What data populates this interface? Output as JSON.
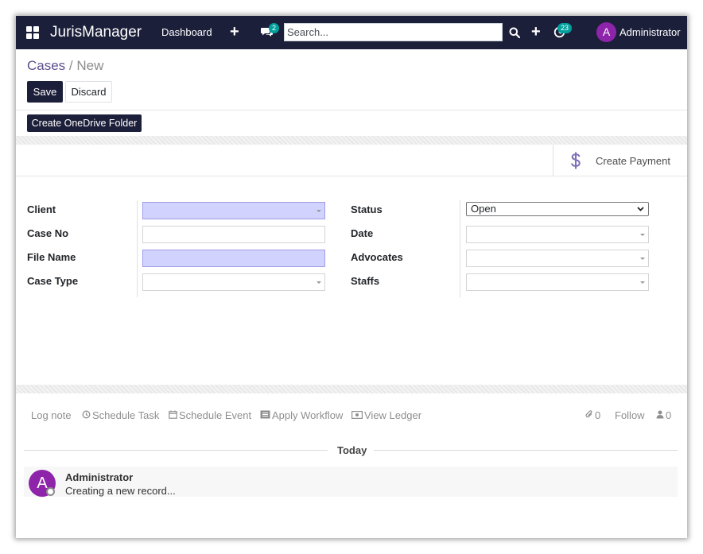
{
  "navbar": {
    "brand": "JurisManager",
    "menu_dashboard": "Dashboard",
    "messages_badge": "2",
    "search_placeholder": "Search...",
    "activity_badge": "23",
    "user_initial": "A",
    "user_name": "Administrator",
    "bg_color": "#1c1f3a",
    "badge_color": "#00a09d"
  },
  "breadcrumb": {
    "parent": "Cases",
    "separator": "/",
    "current": "New"
  },
  "actions": {
    "save": "Save",
    "discard": "Discard",
    "create_onedrive": "Create OneDrive Folder"
  },
  "button_box": {
    "create_payment": "Create Payment",
    "icon": "dollar-icon"
  },
  "form": {
    "left": [
      {
        "label": "Client",
        "value": "",
        "required": true,
        "type": "many2one"
      },
      {
        "label": "Case No",
        "value": "",
        "required": false,
        "type": "char"
      },
      {
        "label": "File Name",
        "value": "",
        "required": true,
        "type": "char"
      },
      {
        "label": "Case Type",
        "value": "",
        "required": false,
        "type": "many2one"
      }
    ],
    "right": [
      {
        "label": "Status",
        "value": "Open",
        "type": "selection"
      },
      {
        "label": "Date",
        "value": "",
        "type": "date"
      },
      {
        "label": "Advocates",
        "value": "",
        "type": "many2many"
      },
      {
        "label": "Staffs",
        "value": "",
        "type": "many2many"
      }
    ],
    "required_color": "#d2d2ff"
  },
  "chatter": {
    "log_note": "Log note",
    "schedule_task": "Schedule Task",
    "schedule_event": "Schedule Event",
    "apply_workflow": "Apply Workflow",
    "view_ledger": "View Ledger",
    "attachments_count": "0",
    "follow": "Follow",
    "followers_count": "0",
    "date_separator": "Today",
    "messages": [
      {
        "avatar_initial": "A",
        "author": "Administrator",
        "body": "Creating a new record..."
      }
    ]
  }
}
